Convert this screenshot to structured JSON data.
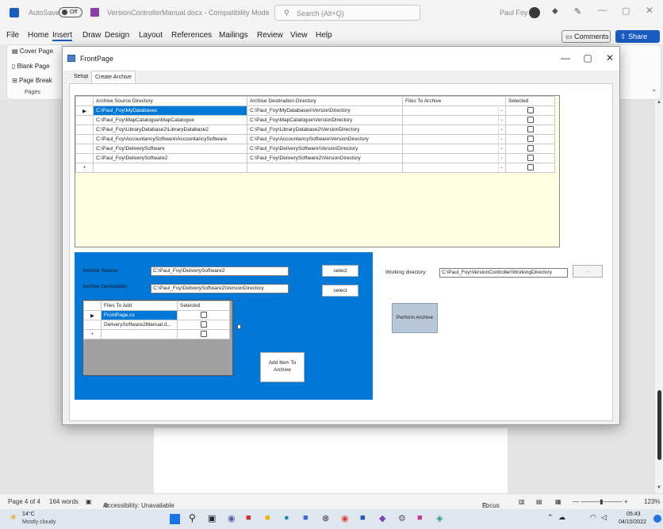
{
  "word": {
    "autosave_label": "AutoSave",
    "autosave_state": "Off",
    "doc_title": "VersionControllerManual.docx - Compatibility Mode",
    "search_placeholder": "Search (Alt+Q)",
    "user": "Paul Foy",
    "tabs": [
      "File",
      "Home",
      "Insert",
      "Draw",
      "Design",
      "Layout",
      "References",
      "Mailings",
      "Review",
      "View",
      "Help"
    ],
    "active_tab": "Insert",
    "comments_label": "Comments",
    "share_label": "Share",
    "pages_group": {
      "items": [
        "Cover Page",
        "Blank Page",
        "Page Break"
      ],
      "label": "Pages"
    }
  },
  "dialog": {
    "title": "FrontPage",
    "tabs": [
      "Setup",
      "Create Archive"
    ],
    "active_tab": "Create Archive",
    "archive_grid": {
      "headers": [
        "Archive Source Directory",
        "Archive Destination Directory",
        "Files To Archive",
        "Selected"
      ],
      "rows": [
        {
          "source": "C:\\Paul_Foy\\MyDatabases",
          "dest": "C:\\Paul_Foy\\MyDatabases\\VersionDirectory"
        },
        {
          "source": "C:\\Paul_Foy\\MapCatalogue\\MapCatalogue",
          "dest": "C:\\Paul_Foy\\MapCatalogue\\VersionDirectory"
        },
        {
          "source": "C:\\Paul_Foy\\LibraryDatabase2\\LibraryDatabase2",
          "dest": "C:\\Paul_Foy\\LibraryDatabase2\\VersionDirectory"
        },
        {
          "source": "C:\\Paul_Foy\\AccountancySoftware\\AccountancySoftware",
          "dest": "C:\\Paul_Foy\\AccountancySoftware\\VersionDirectory"
        },
        {
          "source": "C:\\Paul_Foy\\DeliverySoftware",
          "dest": "C:\\Paul_Foy\\DeliverySoftware\\VersionDirectory"
        },
        {
          "source": "C:\\Paul_Foy\\DeliverySoftware2",
          "dest": "C:\\Paul_Foy\\DeliverySoftware2\\VersionDirectory"
        }
      ]
    },
    "archive_source_label": "Archive Source:",
    "archive_source_value": "C:\\Paul_Foy\\DeliverySoftware2",
    "archive_dest_label": "Archive Destination:",
    "archive_dest_value": "C:\\Paul_Foy\\DeliverySoftware2\\VersionDirectory",
    "select_label": "select",
    "files_grid": {
      "headers": [
        "Files To Add",
        "Selected"
      ],
      "rows": [
        "FrontPage.cs",
        "DeliverySoftware2Manual.d..."
      ]
    },
    "add_item_label": "Add Item To Archive",
    "working_dir_label": "Working directory:",
    "working_dir_value": "C:\\Paul_Foy\\VersionController\\WorkingDirectory",
    "browse_label": "...",
    "perform_label": "Perform Archive"
  },
  "status": {
    "page": "Page 4 of 4",
    "words": "164 words",
    "accessibility": "Accessibility: Unavailable",
    "focus": "Focus",
    "zoom": "123%"
  },
  "taskbar": {
    "weather_temp": "14°C",
    "weather_desc": "Mostly cloudy",
    "time": "05:43",
    "date": "04/10/2022"
  },
  "colors": {
    "accent": "#0078d7",
    "grid_bg": "#ffffe1"
  }
}
